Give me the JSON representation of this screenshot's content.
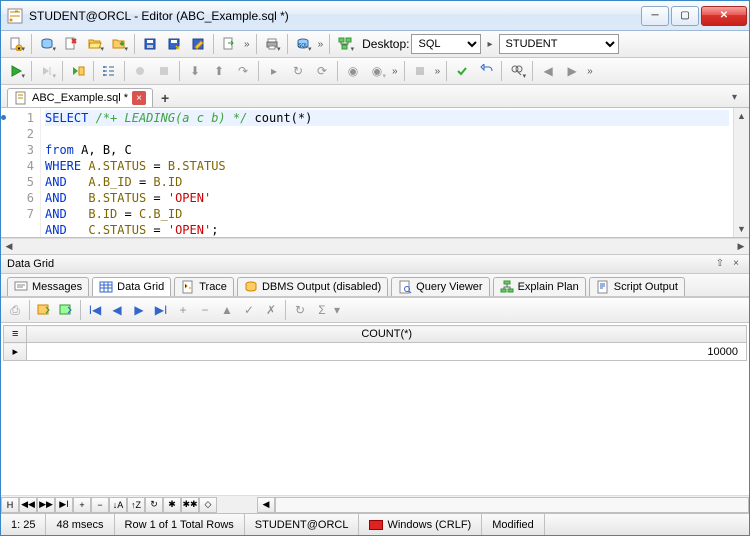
{
  "window": {
    "title": "STUDENT@ORCL - Editor (ABC_Example.sql *)"
  },
  "toolbar1": {
    "desktop_label": "Desktop:",
    "desktop_value": "SQL",
    "connection_value": "STUDENT"
  },
  "filetab": {
    "label": "ABC_Example.sql *"
  },
  "editor": {
    "lines": [
      {
        "n": 1,
        "tokens": [
          {
            "kw": "SELECT"
          },
          {
            "sp": " "
          },
          {
            "cm": "/*+ LEADING(a c b) */"
          },
          {
            "sp": " "
          },
          {
            "txt": "count(*)"
          }
        ]
      },
      {
        "n": 2,
        "tokens": [
          {
            "kw": "from"
          },
          {
            "sp": " "
          },
          {
            "txt": "A, B, C"
          }
        ]
      },
      {
        "n": 3,
        "tokens": [
          {
            "kw": "WHERE"
          },
          {
            "sp": " "
          },
          {
            "id": "A.STATUS"
          },
          {
            "sp": " = "
          },
          {
            "id": "B.STATUS"
          }
        ]
      },
      {
        "n": 4,
        "tokens": [
          {
            "kw": "AND"
          },
          {
            "sp": "   "
          },
          {
            "id": "A.B_ID"
          },
          {
            "sp": " = "
          },
          {
            "id": "B.ID"
          }
        ]
      },
      {
        "n": 5,
        "tokens": [
          {
            "kw": "AND"
          },
          {
            "sp": "   "
          },
          {
            "id": "B.STATUS"
          },
          {
            "sp": " = "
          },
          {
            "str": "'OPEN'"
          }
        ]
      },
      {
        "n": 6,
        "tokens": [
          {
            "kw": "AND"
          },
          {
            "sp": "   "
          },
          {
            "id": "B.ID"
          },
          {
            "sp": " = "
          },
          {
            "id": "C.B_ID"
          }
        ]
      },
      {
        "n": 7,
        "tokens": [
          {
            "kw": "AND"
          },
          {
            "sp": "   "
          },
          {
            "id": "C.STATUS"
          },
          {
            "sp": " = "
          },
          {
            "str": "'OPEN'"
          },
          {
            "txt": ";"
          }
        ]
      }
    ]
  },
  "panel": {
    "title": "Data Grid"
  },
  "result_tabs": {
    "messages": "Messages",
    "datagrid": "Data Grid",
    "trace": "Trace",
    "dbms": "DBMS Output (disabled)",
    "queryviewer": "Query Viewer",
    "explain": "Explain Plan",
    "script": "Script Output"
  },
  "grid": {
    "col": "COUNT(*)",
    "val": "10000"
  },
  "status": {
    "pos": "1: 25",
    "time": "48 msecs",
    "rows": "Row 1 of 1 Total Rows",
    "conn": "STUDENT@ORCL",
    "eol": "Windows (CRLF)",
    "mod": "Modified"
  }
}
